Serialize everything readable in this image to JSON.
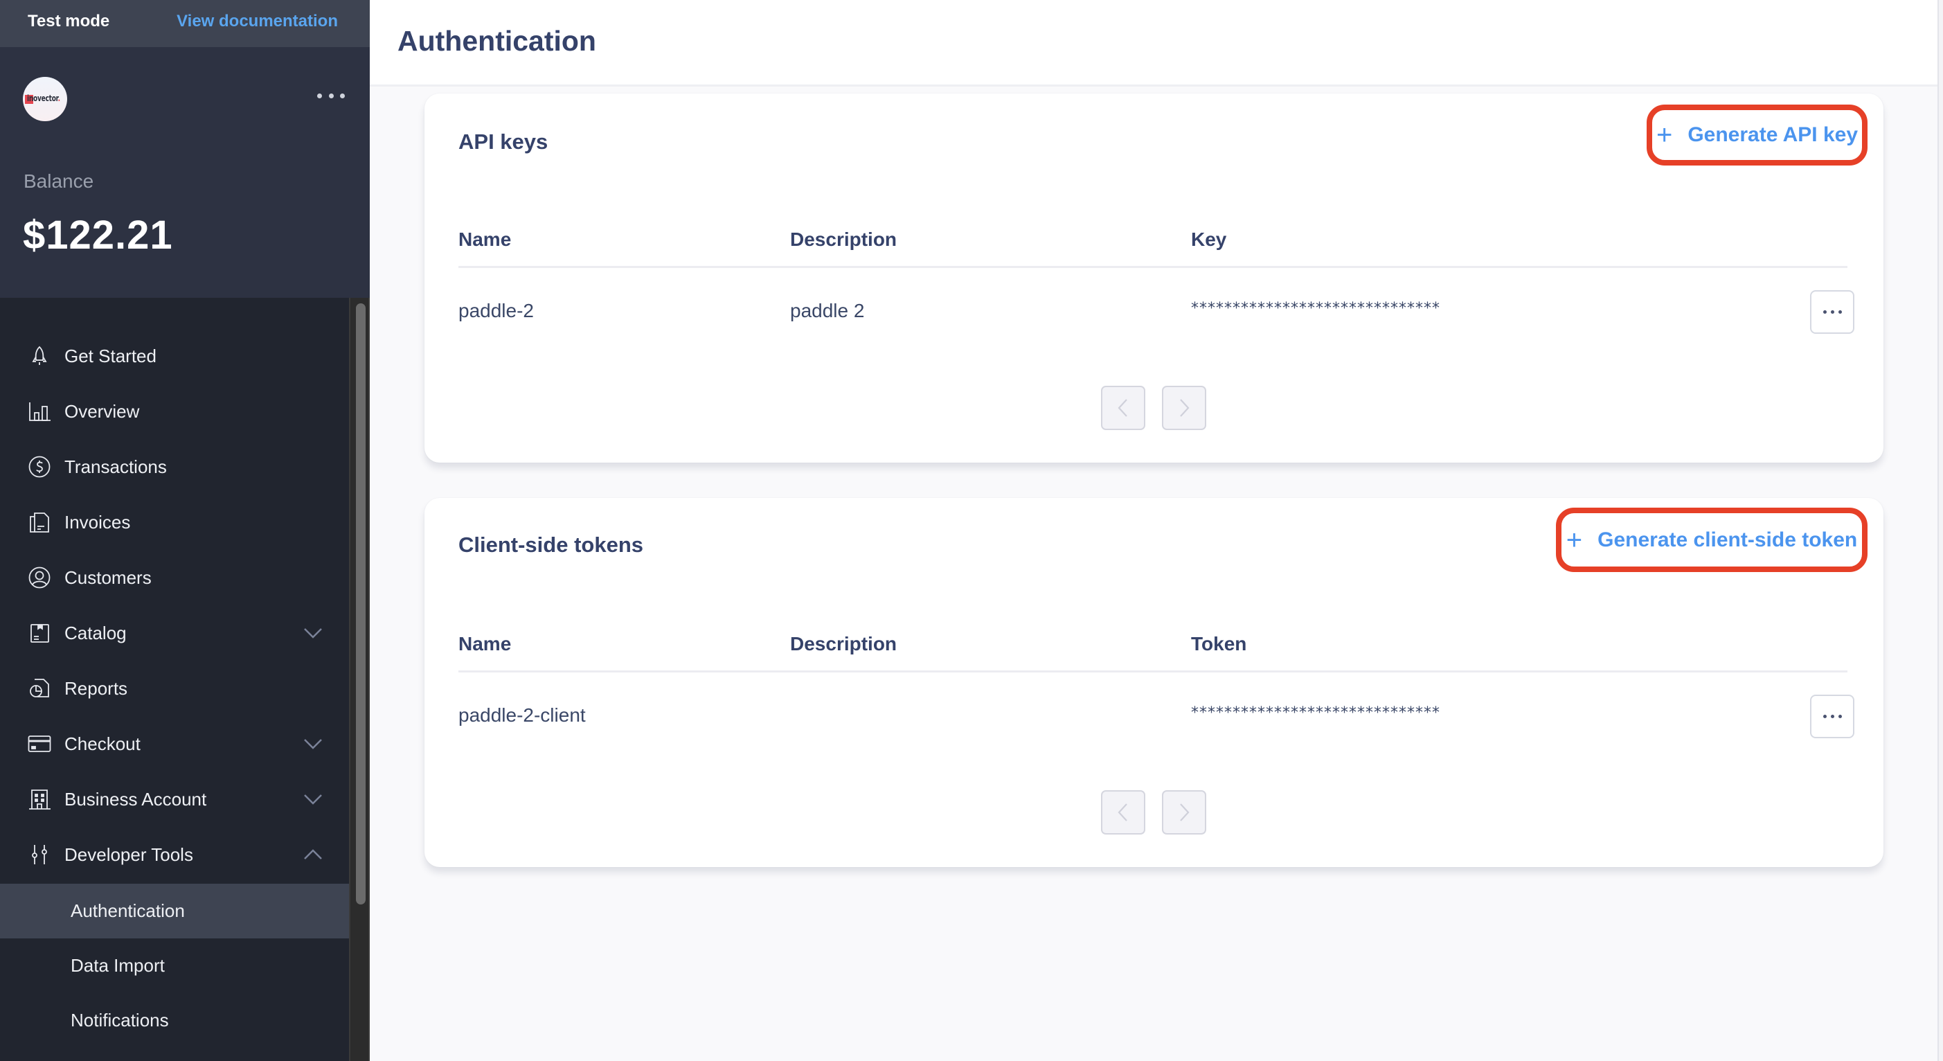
{
  "topbar": {
    "mode_label": "Test mode",
    "docs_link": "View documentation"
  },
  "account": {
    "logo_text": "inovector",
    "logo_dot": ".",
    "balance_label": "Balance",
    "balance_value": "$122.21"
  },
  "sidebar": {
    "items": [
      {
        "label": "Get Started",
        "icon": "rocket-icon"
      },
      {
        "label": "Overview",
        "icon": "bar-chart-icon"
      },
      {
        "label": "Transactions",
        "icon": "dollar-circle-icon"
      },
      {
        "label": "Invoices",
        "icon": "invoice-icon"
      },
      {
        "label": "Customers",
        "icon": "user-circle-icon"
      },
      {
        "label": "Catalog",
        "icon": "catalog-icon",
        "expandable": true,
        "expanded": false
      },
      {
        "label": "Reports",
        "icon": "report-icon"
      },
      {
        "label": "Checkout",
        "icon": "credit-card-icon",
        "expandable": true,
        "expanded": false
      },
      {
        "label": "Business Account",
        "icon": "building-icon",
        "expandable": true,
        "expanded": false
      },
      {
        "label": "Developer Tools",
        "icon": "sliders-icon",
        "expandable": true,
        "expanded": true
      }
    ],
    "sub_items": [
      {
        "label": "Authentication",
        "active": true
      },
      {
        "label": "Data Import",
        "active": false
      },
      {
        "label": "Notifications",
        "active": false
      }
    ]
  },
  "page": {
    "title": "Authentication"
  },
  "api_keys": {
    "title": "API keys",
    "generate_label": "Generate API key",
    "columns": [
      "Name",
      "Description",
      "Key"
    ],
    "rows": [
      {
        "name": "paddle-2",
        "description": "paddle 2",
        "key": "******************************"
      }
    ]
  },
  "client_tokens": {
    "title": "Client-side tokens",
    "generate_label": "Generate client-side token",
    "columns": [
      "Name",
      "Description",
      "Token"
    ],
    "rows": [
      {
        "name": "paddle-2-client",
        "description": "",
        "token": "******************************"
      }
    ]
  },
  "colors": {
    "accent": "#4b94ee",
    "highlight_outline": "#e64027",
    "sidebar_bg": "#21252f",
    "sidebar_active": "#3e4452"
  }
}
